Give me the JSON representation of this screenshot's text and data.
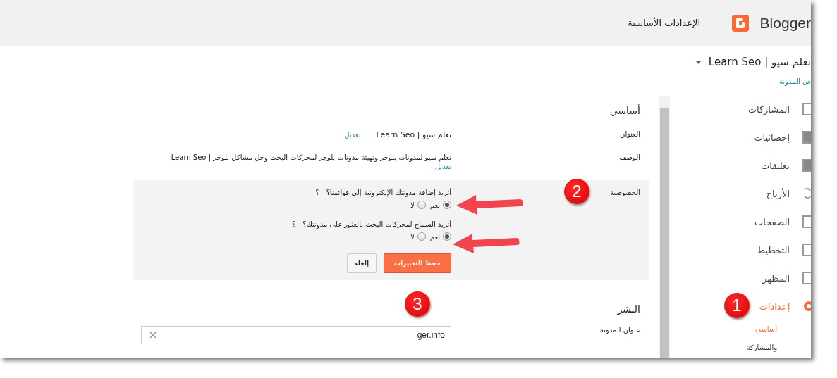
{
  "header": {
    "brand": "Blogger",
    "title": "الإعدادات الأساسية"
  },
  "sidebar": {
    "blog_name": "تعلم سيو | Learn Seo",
    "view_link": "ض المدونة",
    "items": [
      {
        "label": "المشاركات",
        "selected": false
      },
      {
        "label": "إحصائيات",
        "selected": false
      },
      {
        "label": "تعليقات",
        "selected": false
      },
      {
        "label": "الأرباح",
        "selected": false
      },
      {
        "label": "الصفحات",
        "selected": false
      },
      {
        "label": "التخطيط",
        "selected": false
      },
      {
        "label": "المظهر",
        "selected": false
      },
      {
        "label": "إعدادات",
        "selected": true,
        "children": [
          {
            "label": "أساسي",
            "selected": true
          },
          {
            "label": "والمشاركة",
            "selected": false
          }
        ]
      }
    ]
  },
  "basic": {
    "heading": "أساسي",
    "title_row": {
      "label": "العنوان",
      "value": "تعلم سيو | Learn Seo",
      "edit": "تعديل"
    },
    "description_row": {
      "label": "الوصف",
      "value": "تعلم سيو لمدونات بلوجر وتهيئة مدونات بلوجر لمحركات البحث وحل مشاكل بلوجر | Learn Seo",
      "edit": "تعديل"
    },
    "privacy": {
      "label": "الخصوصية",
      "questions": [
        {
          "text": "أتريد إضافة مدونتك الإلكترونية إلى قوائمنا؟",
          "help": "؟",
          "options": [
            {
              "label": "نعم",
              "selected": true
            },
            {
              "label": "لا",
              "selected": false
            }
          ]
        },
        {
          "text": "أتريد السماح لمحركات البحث بالعثور على مدونتك؟",
          "help": "؟",
          "options": [
            {
              "label": "نعم",
              "selected": true
            },
            {
              "label": "لا",
              "selected": false
            }
          ]
        }
      ],
      "save": "حفظ التغييرات",
      "cancel": "إلغاء"
    }
  },
  "publishing": {
    "heading": "النشر",
    "address_label": "عنوان المدونة",
    "address_value": "ger.info"
  },
  "annotations": [
    {
      "number": "1"
    },
    {
      "number": "2"
    },
    {
      "number": "3"
    }
  ]
}
